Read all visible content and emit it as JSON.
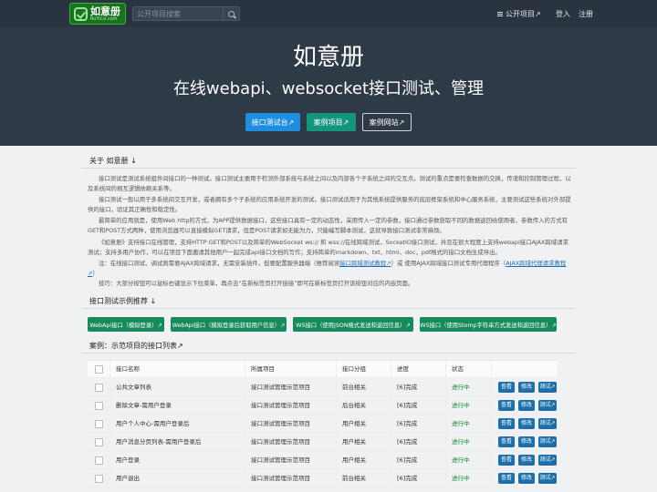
{
  "nav": {
    "logo_cn": "如意册",
    "logo_en": "RuYiCe.com",
    "search_placeholder": "公开项目搜索",
    "public_projects": "公开项目↗",
    "login": "登入",
    "register": "注册"
  },
  "hero": {
    "title": "如意册",
    "subtitle": "在线webapi、websocket接口测试、管理",
    "buttons": [
      "接口测试台↗",
      "案例项目↗",
      "案例网站↗"
    ]
  },
  "about": {
    "title": "关于 如意册 ↓",
    "paragraphs": [
      "接口测试是测试系统组件间接口的一种测试。接口测试主要用于检测外部系统与系统之间以及内部各个子系统之间的交互点。测试的重点是要检查数据的交换，传递和控制管理过程，以及系统间的相互逻辑依赖关系等。",
      "接口测试一般以用于多系统间交互开发，或者拥有多个子系统的应用系统开发的测试。接口测试适用于为其他系统提供服务的底层框架系统和中心服务系统，主要测试这些系统对外部提供的接口，验证其正确性和稳定性。",
      "最简单的应用就是，使用Web http的方式，为APP提供数据接口，这些接口具有一定的动态性，采用传入一定的参数，接口通过参数获取不同的数据返回给使用者，参数传入的方式有GET和POST方式两种，使用浏览器可以直接模拟GET请求，但是POST请求却无能为力，只能编写脚本测试，这就导致接口测试非常麻烦。",
      "《如意册》支持接口在线管理，支持HTTP GET和POST以及简单的WebSocket ws:// 和 wss://在线跨域测试，SocketIO接口测试，并且在很大程度上支持webapi接口AJAX跨域请求测试；支持多用户协作，可以在项目下面邀请其他用户一起完成api接口文档的写作；支持简单的markdown、txt、html、doc、pdf格式的接口文档生成导出。"
    ],
    "note_prefix": "注：在线接口测试、调试则需要AJAX跨域请求，无需安装插件，但要配置服务器端（推荐阅读",
    "note_link1": "接口跨域测试教程↗",
    "note_mid": "）或 使用AJAX跨域接口测试专用代理程序（",
    "note_link2": "AJAX跨域代理请求教程↗",
    "note_suffix": "）",
    "tip": "技巧：大部分按钮可以鼠标右键显示下拉菜单，再点击“在新标签页打开链接”即可在新标签页打开该按钮对应的内嵌页面。"
  },
  "examples": {
    "title": "接口测试示例推荐 ↓",
    "buttons": [
      "WebApi接口（模拟登录）↗",
      "WebApi接口（模拟登录后获取用户信息）↗",
      "WS接口（使用JSON格式发送和返回信息）↗",
      "WS接口（使用Stomp字符串方式发送和返回信息）↗"
    ]
  },
  "table": {
    "title": "案例：示范项目的接口列表↗",
    "headers": [
      "接口名称",
      "所属项目",
      "接口分组",
      "进度",
      "状态"
    ],
    "rows": [
      {
        "name": "公共文章列表",
        "project": "接口测试管理示范项目",
        "group": "前台相关",
        "progress": "[6]完成",
        "status": "进行中"
      },
      {
        "name": "删除文章-需用户登录",
        "project": "接口测试管理示范项目",
        "group": "后台相关",
        "progress": "[6]完成",
        "status": "进行中"
      },
      {
        "name": "用户个人中心-需用户登录后",
        "project": "接口测试管理示范项目",
        "group": "用户相关",
        "progress": "[6]完成",
        "status": "进行中"
      },
      {
        "name": "用户消息分页列表-需用户登录后",
        "project": "接口测试管理示范项目",
        "group": "用户相关",
        "progress": "[6]完成",
        "status": "进行中"
      },
      {
        "name": "用户登录",
        "project": "接口测试管理示范项目",
        "group": "用户相关",
        "progress": "[6]完成",
        "status": "进行中"
      },
      {
        "name": "用户退出",
        "project": "接口测试管理示范项目",
        "group": "前台相关",
        "progress": "[6]完成",
        "status": "进行中"
      }
    ],
    "actions": [
      "查看",
      "修改",
      "测试↗"
    ]
  }
}
